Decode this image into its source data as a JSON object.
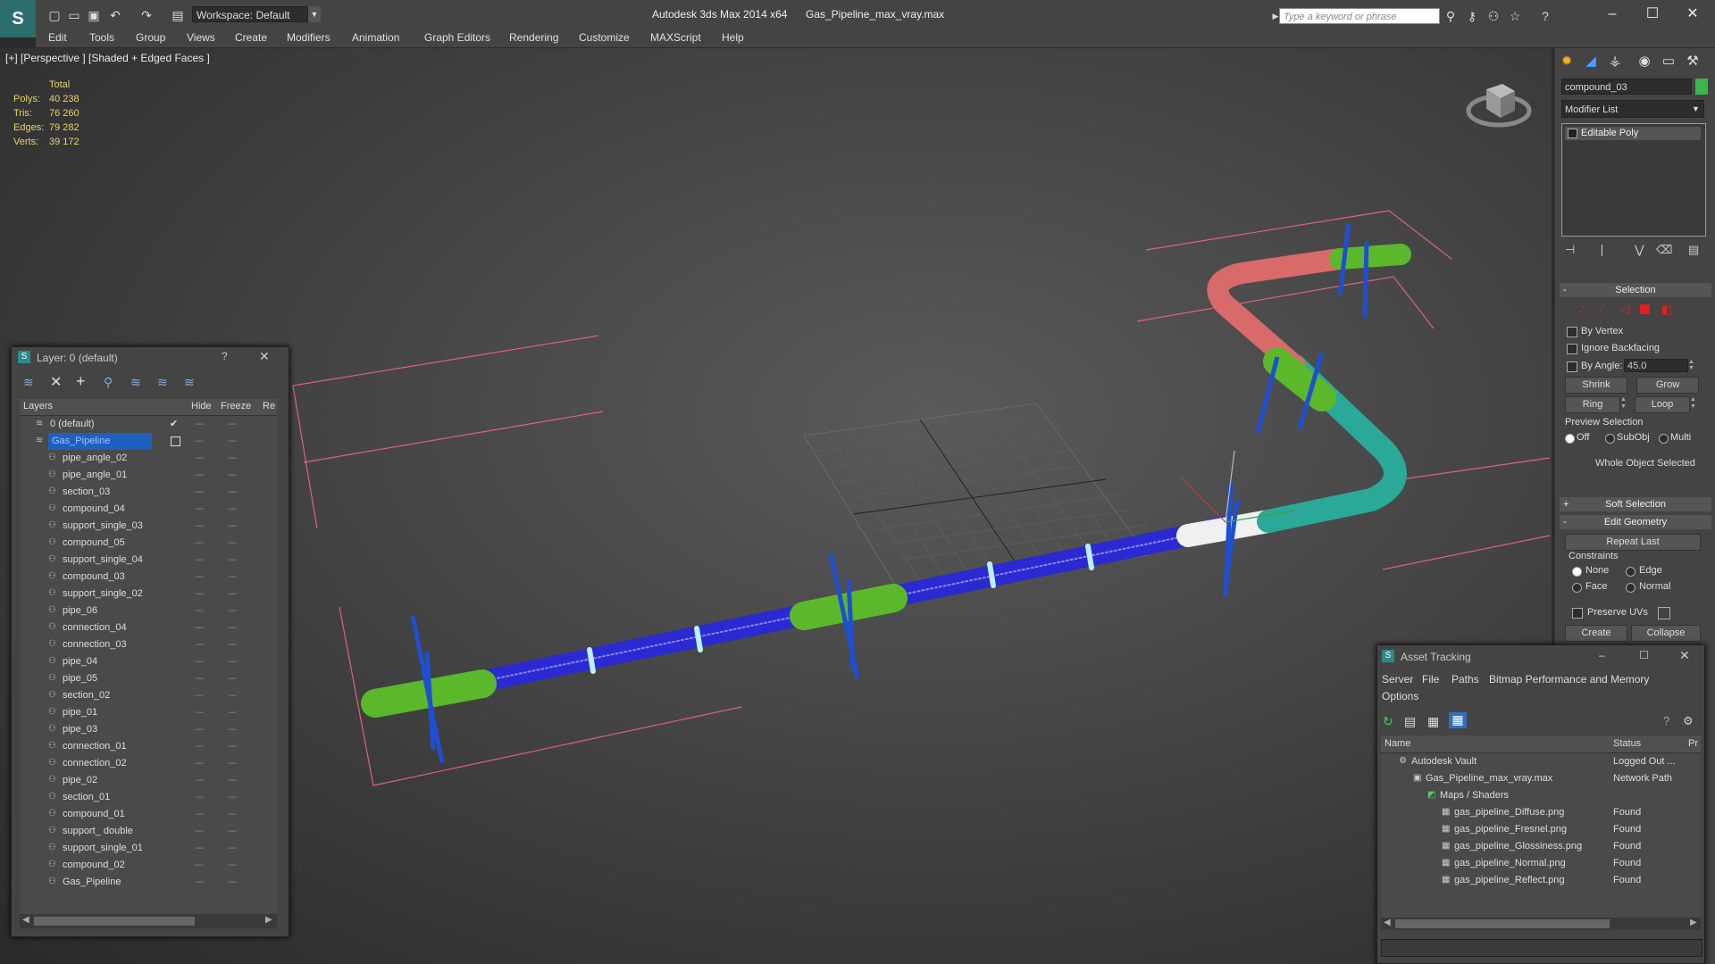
{
  "titlebar": {
    "workspace_label": "Workspace: Default",
    "app_title": "Autodesk 3ds Max  2014 x64",
    "file_title": "Gas_Pipeline_max_vray.max",
    "search_placeholder": "Type a keyword or phrase",
    "minimize": "–",
    "maximize": "☐",
    "close": "✕"
  },
  "menu": [
    "Edit",
    "Tools",
    "Group",
    "Views",
    "Create",
    "Modifiers",
    "Animation",
    "Graph Editors",
    "Rendering",
    "Customize",
    "MAXScript",
    "Help"
  ],
  "viewport": {
    "label": "[+] [Perspective ] [Shaded + Edged Faces ]",
    "stats_header": "Total",
    "stats": [
      {
        "label": "Polys:",
        "value": "40 238"
      },
      {
        "label": "Tris:",
        "value": "76 260"
      },
      {
        "label": "Edges:",
        "value": "79 282"
      },
      {
        "label": "Verts:",
        "value": "39 172"
      }
    ]
  },
  "command_panel": {
    "object_name": "compound_03",
    "object_color": "#3ab54a",
    "modifier_list": "Modifier List",
    "stack_item": "Editable Poly",
    "selection": {
      "title": "Selection",
      "by_vertex": "By Vertex",
      "ignore_backfacing": "Ignore Backfacing",
      "by_angle": "By Angle:",
      "angle_value": "45.0",
      "shrink": "Shrink",
      "grow": "Grow",
      "ring": "Ring",
      "loop": "Loop",
      "preview_selection": "Preview Selection",
      "preview_off": "Off",
      "preview_subobj": "SubObj",
      "preview_multi": "Multi",
      "whole_object": "Whole Object Selected"
    },
    "soft_selection": "Soft Selection",
    "edit_geometry": {
      "title": "Edit Geometry",
      "repeat_last": "Repeat Last",
      "constraints": "Constraints",
      "none": "None",
      "edge": "Edge",
      "face": "Face",
      "normal": "Normal",
      "preserve_uvs": "Preserve UVs",
      "create": "Create",
      "collapse": "Collapse"
    },
    "sign_minus": "-",
    "sign_plus": "+"
  },
  "layer_panel": {
    "title": "Layer: 0 (default)",
    "help": "?",
    "close": "✕",
    "col_layers": "Layers",
    "col_hide": "Hide",
    "col_freeze": "Freeze",
    "col_render": "Re",
    "dots": "----",
    "layers": [
      {
        "name": "0 (default)",
        "level": 0
      },
      {
        "name": "Gas_Pipeline",
        "level": 0,
        "selected": true
      },
      {
        "name": "pipe_angle_02",
        "level": 1
      },
      {
        "name": "pipe_angle_01",
        "level": 1
      },
      {
        "name": "section_03",
        "level": 1
      },
      {
        "name": "compound_04",
        "level": 1
      },
      {
        "name": "support_single_03",
        "level": 1
      },
      {
        "name": "compound_05",
        "level": 1
      },
      {
        "name": "support_single_04",
        "level": 1
      },
      {
        "name": "compound_03",
        "level": 1
      },
      {
        "name": "support_single_02",
        "level": 1
      },
      {
        "name": "pipe_06",
        "level": 1
      },
      {
        "name": "connection_04",
        "level": 1
      },
      {
        "name": "connection_03",
        "level": 1
      },
      {
        "name": "pipe_04",
        "level": 1
      },
      {
        "name": "pipe_05",
        "level": 1
      },
      {
        "name": "section_02",
        "level": 1
      },
      {
        "name": "pipe_01",
        "level": 1
      },
      {
        "name": "pipe_03",
        "level": 1
      },
      {
        "name": "connection_01",
        "level": 1
      },
      {
        "name": "connection_02",
        "level": 1
      },
      {
        "name": "pipe_02",
        "level": 1
      },
      {
        "name": "section_01",
        "level": 1
      },
      {
        "name": "compound_01",
        "level": 1
      },
      {
        "name": "support_ double",
        "level": 1
      },
      {
        "name": "support_single_01",
        "level": 1
      },
      {
        "name": "compound_02",
        "level": 1
      },
      {
        "name": "Gas_Pipeline",
        "level": 1
      }
    ]
  },
  "asset_panel": {
    "title": "Asset Tracking",
    "menu": [
      "Server",
      "File",
      "Paths",
      "Bitmap Performance and Memory",
      "Options"
    ],
    "col_name": "Name",
    "col_status": "Status",
    "col_pr": "Pr",
    "rows": [
      {
        "name": "Autodesk Vault",
        "status": "Logged Out ...",
        "indent": 1
      },
      {
        "name": "Gas_Pipeline_max_vray.max",
        "status": "Network Path",
        "indent": 2
      },
      {
        "name": "Maps / Shaders",
        "status": "",
        "indent": 3
      },
      {
        "name": "gas_pipeline_Diffuse.png",
        "status": "Found",
        "indent": 4
      },
      {
        "name": "gas_pipeline_Fresnel.png",
        "status": "Found",
        "indent": 4
      },
      {
        "name": "gas_pipeline_Glossiness.png",
        "status": "Found",
        "indent": 4
      },
      {
        "name": "gas_pipeline_Normal.png",
        "status": "Found",
        "indent": 4
      },
      {
        "name": "gas_pipeline_Reflect.png",
        "status": "Found",
        "indent": 4
      }
    ]
  },
  "colors": {
    "pipe_blue": "#2a2ad0",
    "pipe_green": "#5ab82a",
    "pipe_red": "#d86a6a",
    "pipe_teal": "#2aa898",
    "support_blue": "#1f4fd0",
    "bbox_pink": "#e06080",
    "selection_blue": "#1f5fbf"
  }
}
